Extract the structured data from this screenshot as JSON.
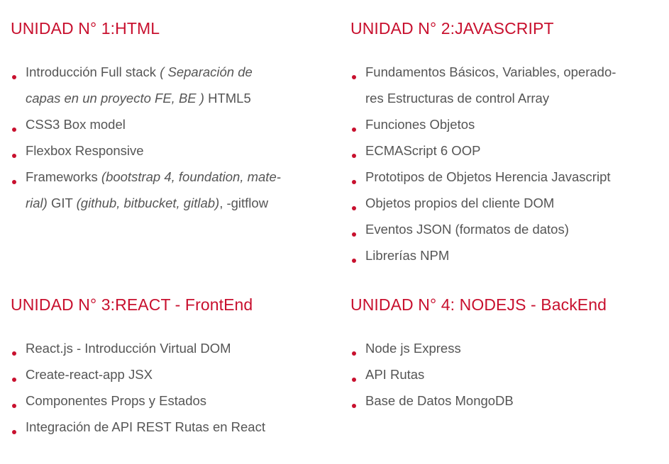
{
  "accent_color": "#c8102e",
  "text_color": "#555555",
  "bullet_icon": "red-dot",
  "units": [
    {
      "title": "UNIDAD N° 1:HTML",
      "items": [
        {
          "line1": {
            "a": "Introducción Full stack ",
            "b": "( Separación de"
          },
          "line2": {
            "a": "capas en un proyecto FE, BE )",
            "b": " HTML5"
          }
        },
        {
          "text": "CSS3 Box model"
        },
        {
          "text": "Flexbox Responsive"
        },
        {
          "line1": {
            "a": "Frameworks ",
            "b": "(bootstrap 4, foundation, mate-"
          },
          "line2": {
            "a": "rial)",
            "b": " GIT ",
            "c": "(github, bitbucket, gitlab)",
            "d": ", -gitflow"
          }
        }
      ]
    },
    {
      "title": "UNIDAD N° 2:JAVASCRIPT",
      "items": [
        {
          "line1": "Fundamentos Básicos, Variables, operado-",
          "line2": "res Estructuras de control Array"
        },
        {
          "text": "Funciones Objetos"
        },
        {
          "text": "ECMAScript 6 OOP"
        },
        {
          "text": "Prototipos de Objetos Herencia Javascript"
        },
        {
          "text": "Objetos propios del cliente DOM"
        },
        {
          "text": "Eventos JSON (formatos de datos)"
        },
        {
          "text": "Librerías NPM"
        }
      ]
    },
    {
      "title": "UNIDAD N° 3:REACT - FrontEnd",
      "items": [
        {
          "text": "React.js - Introducción Virtual DOM"
        },
        {
          "text": "Create-react-app JSX"
        },
        {
          "text": "Componentes Props y Estados"
        },
        {
          "text": "Integración de API REST Rutas en React"
        }
      ]
    },
    {
      "title": "UNIDAD N° 4: NODEJS - BackEnd",
      "items": [
        {
          "text": "Node js Express"
        },
        {
          "text": "API Rutas"
        },
        {
          "text": "Base de Datos MongoDB"
        }
      ]
    }
  ]
}
